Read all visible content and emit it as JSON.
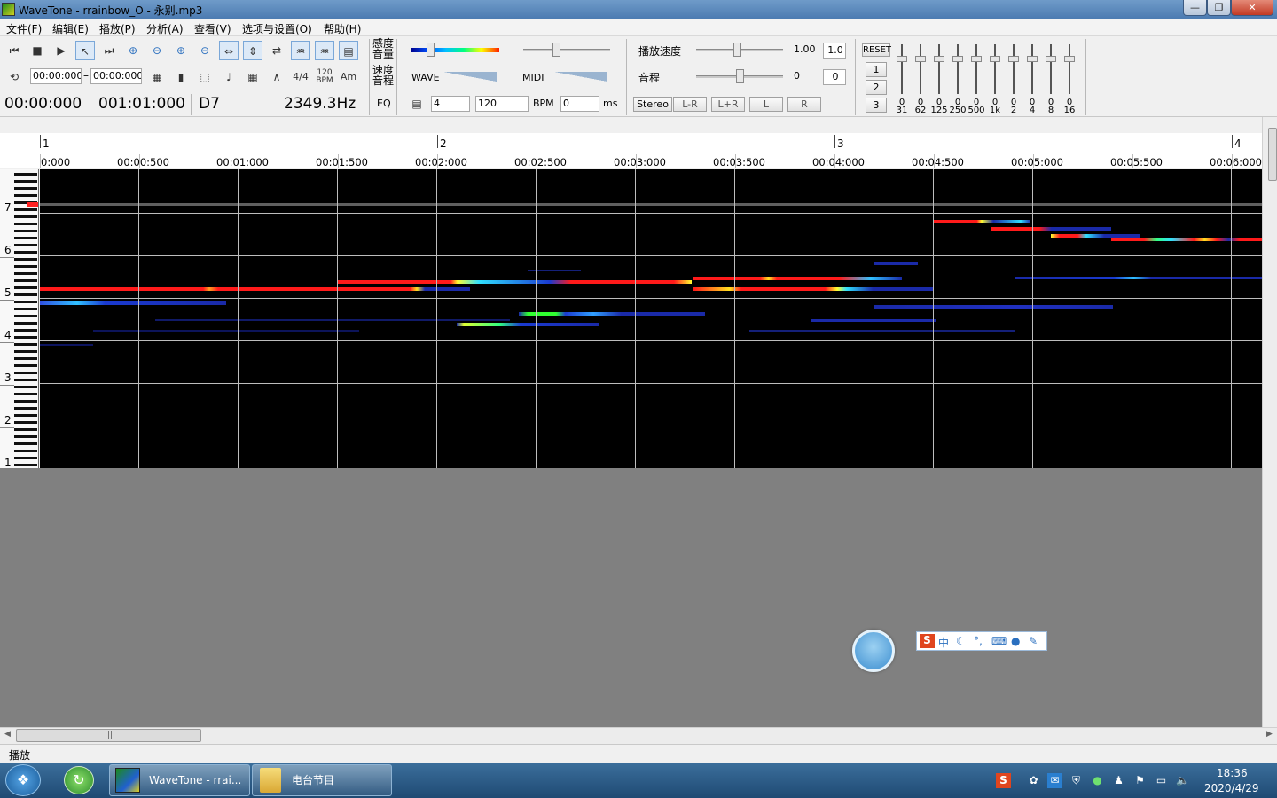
{
  "window": {
    "title": "WaveTone - rrainbow_O - 永别.mp3",
    "min": "—",
    "max": "❐",
    "close": "✕"
  },
  "menu": [
    "文件(F)",
    "编辑(E)",
    "播放(P)",
    "分析(A)",
    "查看(V)",
    "选项与设置(O)",
    "帮助(H)"
  ],
  "transport": {
    "range_start": "00:00:000",
    "range_sep": "–",
    "range_end": "00:00:000",
    "time_sig": "4/4",
    "tempo_icon": "120\nBPM",
    "am": "Am"
  },
  "readout": {
    "position": "00:00:000",
    "bar_beat": "001:01:000",
    "note": "D7",
    "freq": "2349.3Hz"
  },
  "labels": {
    "sens_vol": "感度\n音量",
    "speed_pitch": "速度\n音程",
    "eq": "EQ",
    "wave": "WAVE",
    "midi": "MIDI",
    "beats": "4",
    "bpm_value": "120",
    "bpm": "BPM",
    "offset": "0",
    "ms": "ms",
    "playback_speed": "播放速度",
    "speed_value": "1.00",
    "speed_box": "1.0",
    "pitch": "音程",
    "pitch_value": "0",
    "pitch_box": "0",
    "stereo": "Stereo",
    "lr_minus": "L-R",
    "lr_plus": "L+R",
    "left": "L",
    "right": "R"
  },
  "eq_panel": {
    "reset": "RESET",
    "presets": [
      "1",
      "2",
      "3"
    ],
    "bands": [
      "31",
      "62",
      "125",
      "250",
      "500",
      "1k",
      "2",
      "4",
      "8",
      "16"
    ],
    "values": [
      "0",
      "0",
      "0",
      "0",
      "0",
      "0",
      "0",
      "0",
      "0",
      "0"
    ]
  },
  "ruler": {
    "bars": [
      "1",
      "2",
      "3",
      "4"
    ],
    "times": [
      "0:000",
      "00:00:500",
      "00:01:000",
      "00:01:500",
      "00:02:000",
      "00:02:500",
      "00:03:000",
      "00:03:500",
      "00:04:000",
      "00:04:500",
      "00:05:000",
      "00:05:500",
      "00:06:000"
    ]
  },
  "piano": {
    "octaves": [
      "7",
      "6",
      "5",
      "4",
      "3",
      "2",
      "1"
    ]
  },
  "status": "播放",
  "taskbar": {
    "tasks": [
      {
        "label": "WaveTone - rrai..."
      },
      {
        "label": "电台节目"
      }
    ],
    "time": "18:36",
    "date": "2020/4/29"
  },
  "colors": {
    "title_bar": "#5a88bc",
    "spectro_bg": "#000000",
    "note_hot": "#ff1a1a",
    "note_cold": "#1a2aa8",
    "lower_area": "#808080"
  }
}
